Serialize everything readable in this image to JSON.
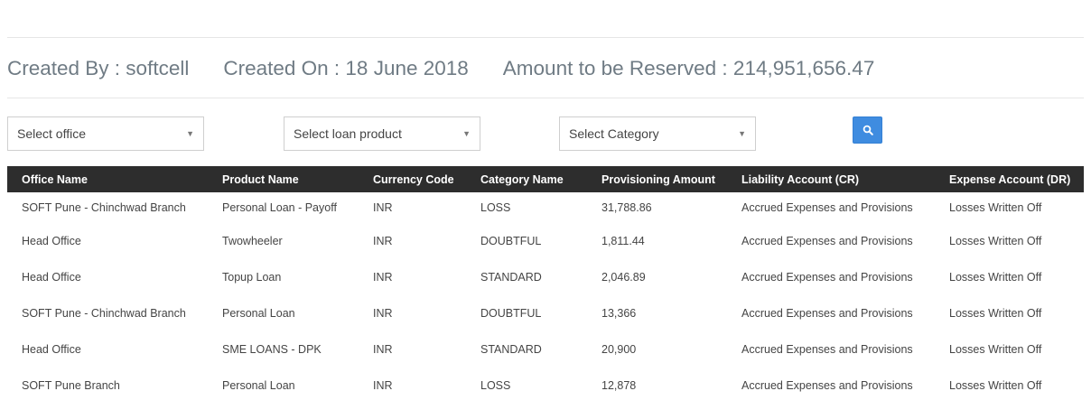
{
  "summary": {
    "created_by": "Created By : softcell",
    "created_on": "Created On : 18 June 2018",
    "amount": "Amount to be Reserved : 214,951,656.47"
  },
  "filters": {
    "office": "Select office",
    "loan_product": "Select loan product",
    "category": "Select Category",
    "search_icon": "search-icon",
    "search_color": "#3f8ce0"
  },
  "table": {
    "header_bg": "#2d2d2d",
    "columns": [
      "Office Name",
      "Product Name",
      "Currency Code",
      "Category Name",
      "Provisioning Amount",
      "Liability Account (CR)",
      "Expense Account (DR)"
    ],
    "rows": [
      [
        "SOFT Pune - Chinchwad Branch",
        "Personal Loan - Payoff",
        "INR",
        "LOSS",
        "31,788.86",
        "Accrued Expenses and Provisions",
        "Losses Written Off"
      ],
      [
        "Head Office",
        "Twowheeler",
        "INR",
        "DOUBTFUL",
        "1,811.44",
        "Accrued Expenses and Provisions",
        "Losses Written Off"
      ],
      [
        "Head Office",
        "Topup Loan",
        "INR",
        "STANDARD",
        "2,046.89",
        "Accrued Expenses and Provisions",
        "Losses Written Off"
      ],
      [
        "SOFT Pune - Chinchwad Branch",
        "Personal Loan",
        "INR",
        "DOUBTFUL",
        "13,366",
        "Accrued Expenses and Provisions",
        "Losses Written Off"
      ],
      [
        "Head Office",
        "SME LOANS - DPK",
        "INR",
        "STANDARD",
        "20,900",
        "Accrued Expenses and Provisions",
        "Losses Written Off"
      ],
      [
        "SOFT Pune Branch",
        "Personal Loan",
        "INR",
        "LOSS",
        "12,878",
        "Accrued Expenses and Provisions",
        "Losses Written Off"
      ]
    ]
  }
}
